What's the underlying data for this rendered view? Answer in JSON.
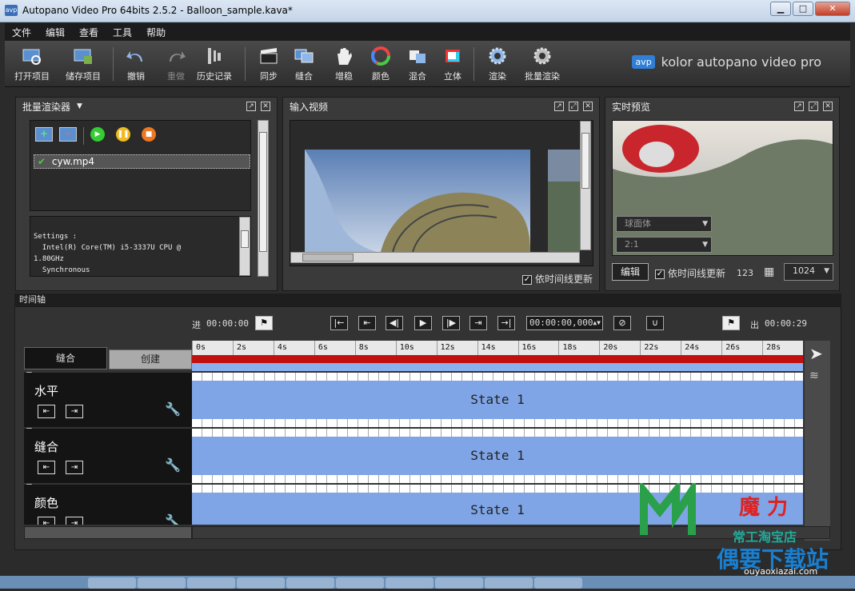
{
  "window": {
    "title": "Autopano Video Pro 64bits 2.5.2 - Balloon_sample.kava*",
    "app_icon": "avp"
  },
  "menu": [
    "文件",
    "编辑",
    "查看",
    "工具",
    "帮助"
  ],
  "toolbar": {
    "open": "打开项目",
    "save": "储存项目",
    "undo": "撤销",
    "redo": "重做",
    "history": "历史记录",
    "sync": "同步",
    "stitch": "缝合",
    "stabilize": "增稳",
    "color": "颜色",
    "blend": "混合",
    "stereo": "立体",
    "render": "渲染",
    "batch_render": "批量渲染"
  },
  "brand": {
    "logo": "avp",
    "text": "kolor autopano video pro"
  },
  "batch_panel": {
    "title": "批量渲染器",
    "file": "cyw.mp4",
    "settings_lines": [
      "Settings :",
      "  Intel(R) Core(TM) i5-3337U CPU @",
      "1.80GHz",
      "  Synchronous"
    ]
  },
  "input_panel": {
    "title": "输入视频",
    "timeline_update": "依时间线更新"
  },
  "preview_panel": {
    "title": "实时预览",
    "projection": "球面体",
    "ratio": "2:1",
    "edit": "编辑",
    "timeline_update": "依时间线更新",
    "num": "123",
    "width": "1024"
  },
  "timeline": {
    "title": "时间轴",
    "in_label": "进",
    "in_time": "00:00:00",
    "out_label": "出",
    "out_time": "00:00:29",
    "current": "00:00:00,000",
    "tabs": [
      "缝合",
      "创建"
    ],
    "ticks": [
      "0s",
      "2s",
      "4s",
      "6s",
      "8s",
      "10s",
      "12s",
      "14s",
      "16s",
      "18s",
      "20s",
      "22s",
      "24s",
      "26s",
      "28s"
    ],
    "tracks": [
      {
        "name": "水平",
        "state": "State 1"
      },
      {
        "name": "缝合",
        "state": "State 1"
      },
      {
        "name": "颜色",
        "state": "State 1"
      }
    ]
  },
  "watermark": {
    "text1": "魔 力",
    "text2": "常工淘宝店",
    "text3": "偶要下载站",
    "url": "ouyaoxiazai.com"
  }
}
